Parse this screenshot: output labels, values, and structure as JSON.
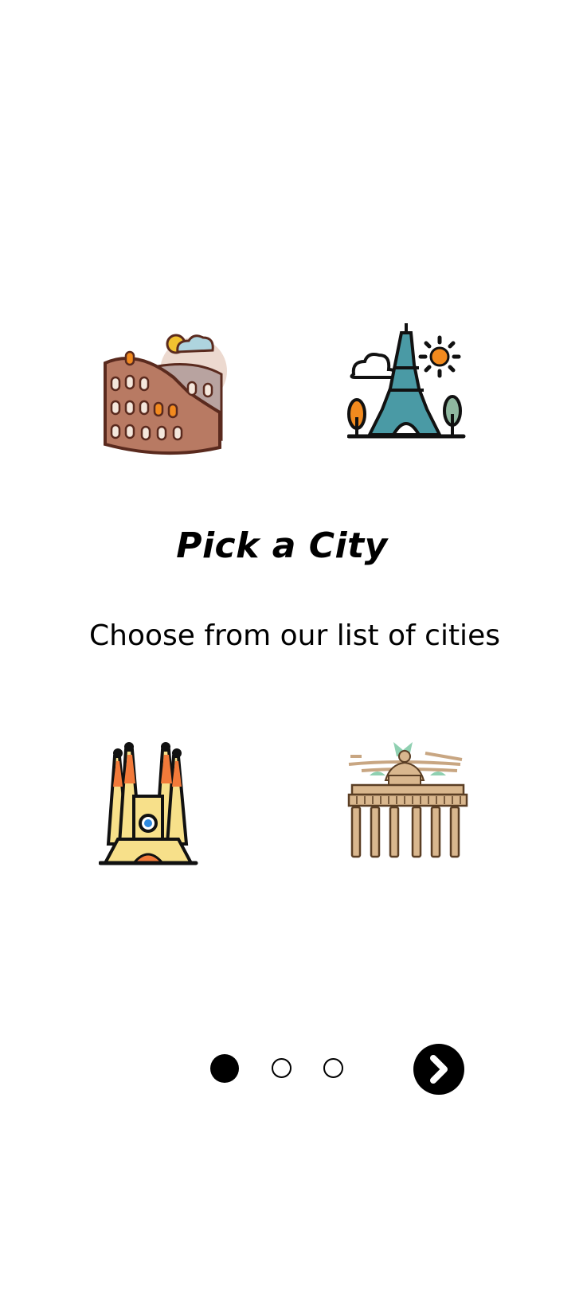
{
  "onboarding": {
    "title": "Pick a City",
    "subtitle": "Choose from our list of cities",
    "landmarks": [
      "colosseum-icon",
      "eiffel-tower-icon",
      "sagrada-familia-icon",
      "brandenburg-gate-icon"
    ],
    "pagination": {
      "total": 3,
      "current": 1
    },
    "next_button_icon": "chevron-right-icon"
  },
  "colors": {
    "background": "#ffffff",
    "text": "#000000",
    "dot_active": "#000000",
    "button": "#000000"
  }
}
